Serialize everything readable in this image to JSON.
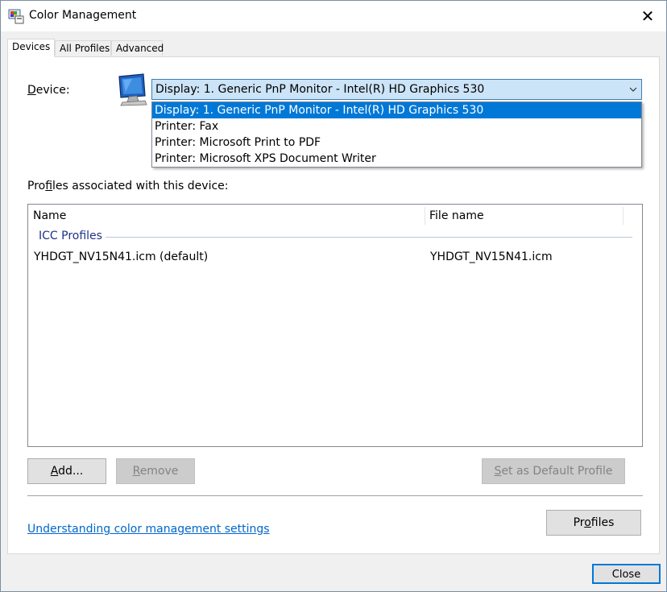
{
  "window": {
    "title": "Color Management"
  },
  "tabs": [
    {
      "label": "Devices",
      "active": true
    },
    {
      "label": "All Profiles",
      "active": false
    },
    {
      "label": "Advanced",
      "active": false
    }
  ],
  "device": {
    "label_access": "D",
    "label_rest": "evice:",
    "selected": "Display: 1. Generic PnP Monitor - Intel(R) HD Graphics 530",
    "options": [
      "Display: 1. Generic PnP Monitor - Intel(R) HD Graphics 530",
      "Printer: Fax",
      "Printer: Microsoft Print to PDF",
      "Printer: Microsoft XPS Document Writer"
    ]
  },
  "profiles_section": {
    "label_pre": "Pro",
    "label_access": "f",
    "label_post": "iles associated with this device:",
    "columns": [
      "Name",
      "File name"
    ],
    "group": "ICC Profiles",
    "rows": [
      {
        "name": "YHDGT_NV15N41.icm (default)",
        "file": "YHDGT_NV15N41.icm"
      }
    ]
  },
  "buttons": {
    "add_access": "A",
    "add_rest": "dd...",
    "remove_access": "R",
    "remove_rest": "emove",
    "setdefault_access": "S",
    "setdefault_rest": "et as Default Profile",
    "profiles_pre": "Pr",
    "profiles_access": "o",
    "profiles_post": "files",
    "close": "Close"
  },
  "link": {
    "text": "Understanding color management settings"
  },
  "colors": {
    "accent": "#0078d7",
    "link": "#0066cc",
    "group": "#1e3287"
  }
}
